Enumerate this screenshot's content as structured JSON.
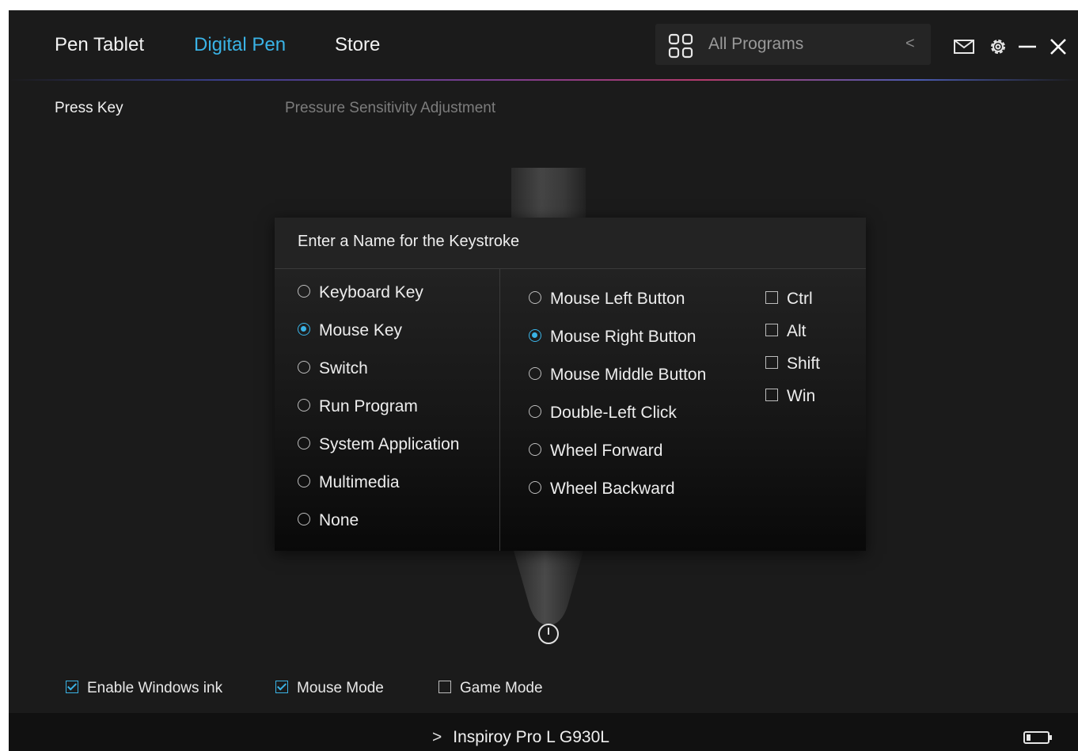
{
  "header": {
    "tabs": [
      {
        "label": "Pen Tablet",
        "active": false
      },
      {
        "label": "Digital Pen",
        "active": true
      },
      {
        "label": "Store",
        "active": false
      }
    ],
    "program_selector": {
      "label": "All Programs",
      "icon": "apps-grid-icon",
      "arrow": "<"
    },
    "icons": [
      "mail-icon",
      "gear-icon",
      "minimize-icon",
      "close-icon"
    ]
  },
  "subtabs": {
    "press_key": "Press Key",
    "pressure": "Pressure Sensitivity Adjustment"
  },
  "dialog": {
    "title": "Enter a Name for the Keystroke",
    "key_types": [
      {
        "label": "Keyboard Key",
        "selected": false
      },
      {
        "label": "Mouse Key",
        "selected": true
      },
      {
        "label": "Switch",
        "selected": false
      },
      {
        "label": "Run Program",
        "selected": false
      },
      {
        "label": "System Application",
        "selected": false
      },
      {
        "label": "Multimedia",
        "selected": false
      },
      {
        "label": "None",
        "selected": false
      }
    ],
    "mouse_options": [
      {
        "label": "Mouse Left Button",
        "selected": false
      },
      {
        "label": "Mouse Right Button",
        "selected": true
      },
      {
        "label": "Mouse Middle Button",
        "selected": false
      },
      {
        "label": "Double-Left Click",
        "selected": false
      },
      {
        "label": "Wheel Forward",
        "selected": false
      },
      {
        "label": "Wheel Backward",
        "selected": false
      }
    ],
    "modifiers": [
      {
        "label": "Ctrl",
        "checked": false
      },
      {
        "label": "Alt",
        "checked": false
      },
      {
        "label": "Shift",
        "checked": false
      },
      {
        "label": "Win",
        "checked": false
      }
    ]
  },
  "bottom_options": [
    {
      "label": "Enable Windows ink",
      "checked": true
    },
    {
      "label": "Mouse Mode",
      "checked": true
    },
    {
      "label": "Game Mode",
      "checked": false
    }
  ],
  "status": {
    "arrow": ">",
    "device_name": "Inspiroy Pro L G930L",
    "battery_icon": "battery-icon"
  },
  "colors": {
    "accent": "#3ab3e6",
    "background": "#1b1b1b",
    "statusbar": "#111111"
  }
}
